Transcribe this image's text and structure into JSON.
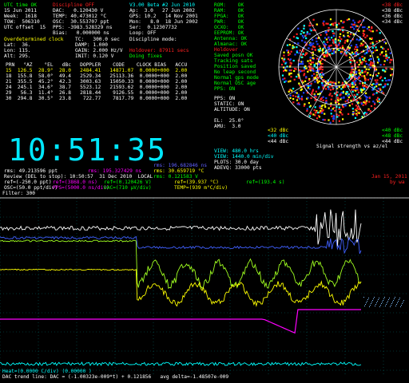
{
  "colors": {
    "green": "#00ff00",
    "cyan": "#00ffff",
    "yellow": "#ffff00",
    "red": "#ff2020",
    "blue": "#5050ff",
    "magenta": "#ff00ff",
    "white": "#ffffff"
  },
  "status": {
    "l1": "UTC time OK",
    "l1b": "Discipline OFF",
    "l2": "15 Jun 2011",
    "l2b": "DAC:   0.120430 V",
    "l3": "Week:  1618",
    "l3b": "TEMP: 40.473012 °C",
    "l4": "TOW:  506310",
    "l4b": "OSC:  30.553707 ppt",
    "l5": "UTC offset  15",
    "l5b": "PPS: -3983.528329 ns",
    "l6": "",
    "l6b": "Bias:   0.000000 ns"
  },
  "version": {
    "v": "V3.00 Beta #2 Jun 2010",
    "a": "Ap:  3.0   27 Jun 2002",
    "b": "GPS: 10.2   14 Nov 2001",
    "c": "Mon:   8.0  18 Jun 2002",
    "d": "Ser:  0.12307732",
    "e": "Loop: OFF"
  },
  "flags": [
    "ROM:    OK",
    "RAM:    OK",
    "FPGA:   OK",
    "PWR:    OK",
    "OCXO:   OK",
    "EEPROM: OK",
    "Antenna: OK",
    "Almanac: OK",
    "Holdover",
    "Saved posn OK",
    "Tracking sats",
    "Position saved",
    "No leap second",
    "Normal gps mode",
    "Normal OSC age",
    "",
    "PPS: ON"
  ],
  "discipline": {
    "h1": "Overdetermined clock",
    "h2": "Discipline mode:",
    "tc": "TC:   300.0 sec",
    "damp": "DAMP: 1.000",
    "gain": "GAIN: 2.000 Hz/V",
    "init": "INIT: 0.120 V",
    "hold": "Holdover: 87911 secs",
    "fix": "Doing fixes"
  },
  "position": {
    "lat": "Lat:  36.",
    "lon": "Lon: 115.",
    "alt": "Alt: 295."
  },
  "sats": {
    "header": "PRN   °AZ    °EL   dBc   DOPPLER    CODE    CLOCK BIAS   ACCU",
    "rows": [
      "15  126.5  28.9°  28.0   2484.41   14871.07  0.0000+000  2.00",
      "18  155.8  58.0°  49.4   2529.34   25113.36  0.0000+000  2.00",
      "21  355.5  45.2°  42.3   3003.63   15050.33  0.0000+000  2.00",
      "24  245.1  34.6°  38.7   5523.12   21593.62  0.0000+000  2.00",
      "29   56.3  11.4°  26.8   2818.44    9126.55  0.0000+000  2.00",
      "30  294.8  30.5°  23.8    722.77    7817.79  0.0000+000  2.00"
    ]
  },
  "clock": "10:51:35",
  "polar": {
    "title": "Signal strength vs az/el",
    "el": "EL:  25.0°",
    "amu": "AMU:  3.0",
    "legend_r": [
      "<38 dBc",
      "<38 dBc",
      "<36 dBc",
      "<34 dBc"
    ],
    "legend_l": [
      "<32 dBc",
      "<40 dBc",
      "<44 dBc"
    ],
    "legend_g": [
      "<40 dBc",
      "<48 dBc",
      "<44 dBc"
    ],
    "params": [
      "PPS: ON",
      "STATIC: ON",
      "ALTITUDE: ON"
    ]
  },
  "view": {
    "a": "VIEW: 480.0 hrs",
    "b": "VIEW: 1440.0 min/div",
    "c": "PLOTS: 30.0 day",
    "d": "ADEVQ: 33000 pts"
  },
  "plotinfo": {
    "r1a": "rms: 49.213596 ppt",
    "r1b": "rms: 195.327429 ns",
    "r1c": "rms: 196.682846 ns",
    "r2a": "Review (DEL to stop): 10:50:57  31 Dec 2010  LOCAL",
    "r2b": "rms: 30.659719 °C",
    "r2c": "rms: 0.121583 V",
    "r3a": "ref=(-250.0 ppt)",
    "r3b": "ref=(3868.0 ns)",
    "r3c": "ref=(0.120426 V)",
    "r3d": "ref=(39.937 °C)",
    "r3e": "ref=(193.4 s)",
    "r4a": "OSC=(50.0 ppt/div)",
    "r4b": "PPS=(5000.0 ns/div)",
    "r4c": "DAC=(710 µV/div)",
    "r4d": "TEMP=(939 m°C/div)",
    "date": "Jan 15, 2011",
    "by": "by wa"
  },
  "filter": "Filter: 300",
  "footer": {
    "f1": "Heat=(0.0000 C/div) (0.00000 )",
    "f2": "DAC trend line: DAC = (-1.00323e-009*t) + 0.121856   avg delta=-1.48507e-009"
  },
  "plot": {
    "osc": [
      0.66,
      0.66,
      0.65,
      0.66,
      0.65,
      0.66,
      0.66,
      0.65,
      0.66,
      0.66,
      0.66,
      0.65,
      0.66,
      0.65,
      0.66,
      0.66,
      0.65,
      0.66,
      0.66,
      0.65,
      0.66,
      0.66,
      0.65,
      0.66,
      0.66,
      0.65,
      0.66,
      0.65,
      0.66,
      0.64,
      0.66,
      0.65,
      0.65,
      0.66,
      0.65,
      0.66,
      0.64,
      0.65,
      0.66,
      0.64,
      0.65,
      0.66,
      0.64,
      0.6,
      0.7,
      0.62,
      0.66,
      0.66,
      0.5,
      0.7,
      0.2,
      0.9,
      0.55
    ]
  }
}
